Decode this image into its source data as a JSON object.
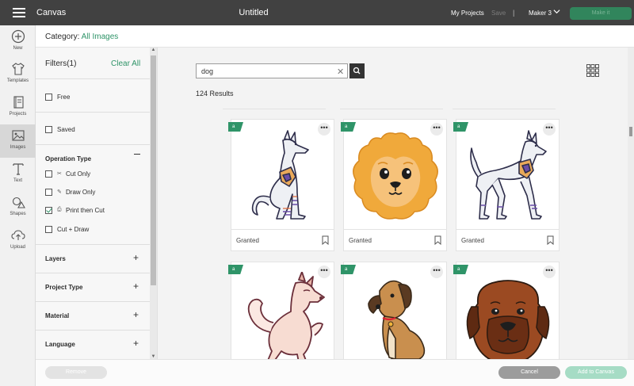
{
  "topbar": {
    "app_title": "Canvas",
    "doc_title": "Untitled",
    "my_projects": "My Projects",
    "save": "Save",
    "separator": "|",
    "machine": "Maker 3",
    "make_it": "Make it"
  },
  "nav": {
    "items": [
      {
        "label": "New",
        "icon": "plus-circle-icon"
      },
      {
        "label": "Templates",
        "icon": "shirt-icon"
      },
      {
        "label": "Projects",
        "icon": "book-icon"
      },
      {
        "label": "Images",
        "icon": "image-icon"
      },
      {
        "label": "Text",
        "icon": "text-icon"
      },
      {
        "label": "Shapes",
        "icon": "shapes-icon"
      },
      {
        "label": "Upload",
        "icon": "upload-cloud-icon"
      }
    ],
    "active": "Images"
  },
  "category": {
    "label": "Category:",
    "value": "All Images"
  },
  "filters": {
    "title": "Filters(1)",
    "clear_all": "Clear All",
    "free": {
      "label": "Free",
      "checked": false
    },
    "saved": {
      "label": "Saved",
      "checked": false
    },
    "operation_type": {
      "title": "Operation Type",
      "options": [
        {
          "label": "Cut Only",
          "icon": "scissors-icon",
          "checked": false
        },
        {
          "label": "Draw Only",
          "icon": "pen-icon",
          "checked": false
        },
        {
          "label": "Print then Cut",
          "icon": "printer-icon",
          "checked": true
        },
        {
          "label": "Cut + Draw",
          "icon": "",
          "checked": false
        }
      ]
    },
    "sections": [
      "Layers",
      "Project Type",
      "Material",
      "Language"
    ]
  },
  "search": {
    "value": "dog",
    "results": "124 Results"
  },
  "cards": [
    {
      "label": "Granted",
      "art": "anubis-dog-sitting"
    },
    {
      "label": "Granted",
      "art": "pomeranian-face"
    },
    {
      "label": "Granted",
      "art": "anubis-dog-standing"
    },
    {
      "label": "",
      "art": "shiba-dog-sitting"
    },
    {
      "label": "",
      "art": "brown-puppy-sitting"
    },
    {
      "label": "",
      "art": "mastiff-face"
    }
  ],
  "badge_glyph": "a",
  "more_glyph": "•••",
  "bottom": {
    "remove": "Remove",
    "cancel": "Cancel",
    "add": "Add to Canvas"
  },
  "colors": {
    "topbar": "#414141",
    "accent": "#2f9468",
    "make_it": "#31855c"
  }
}
